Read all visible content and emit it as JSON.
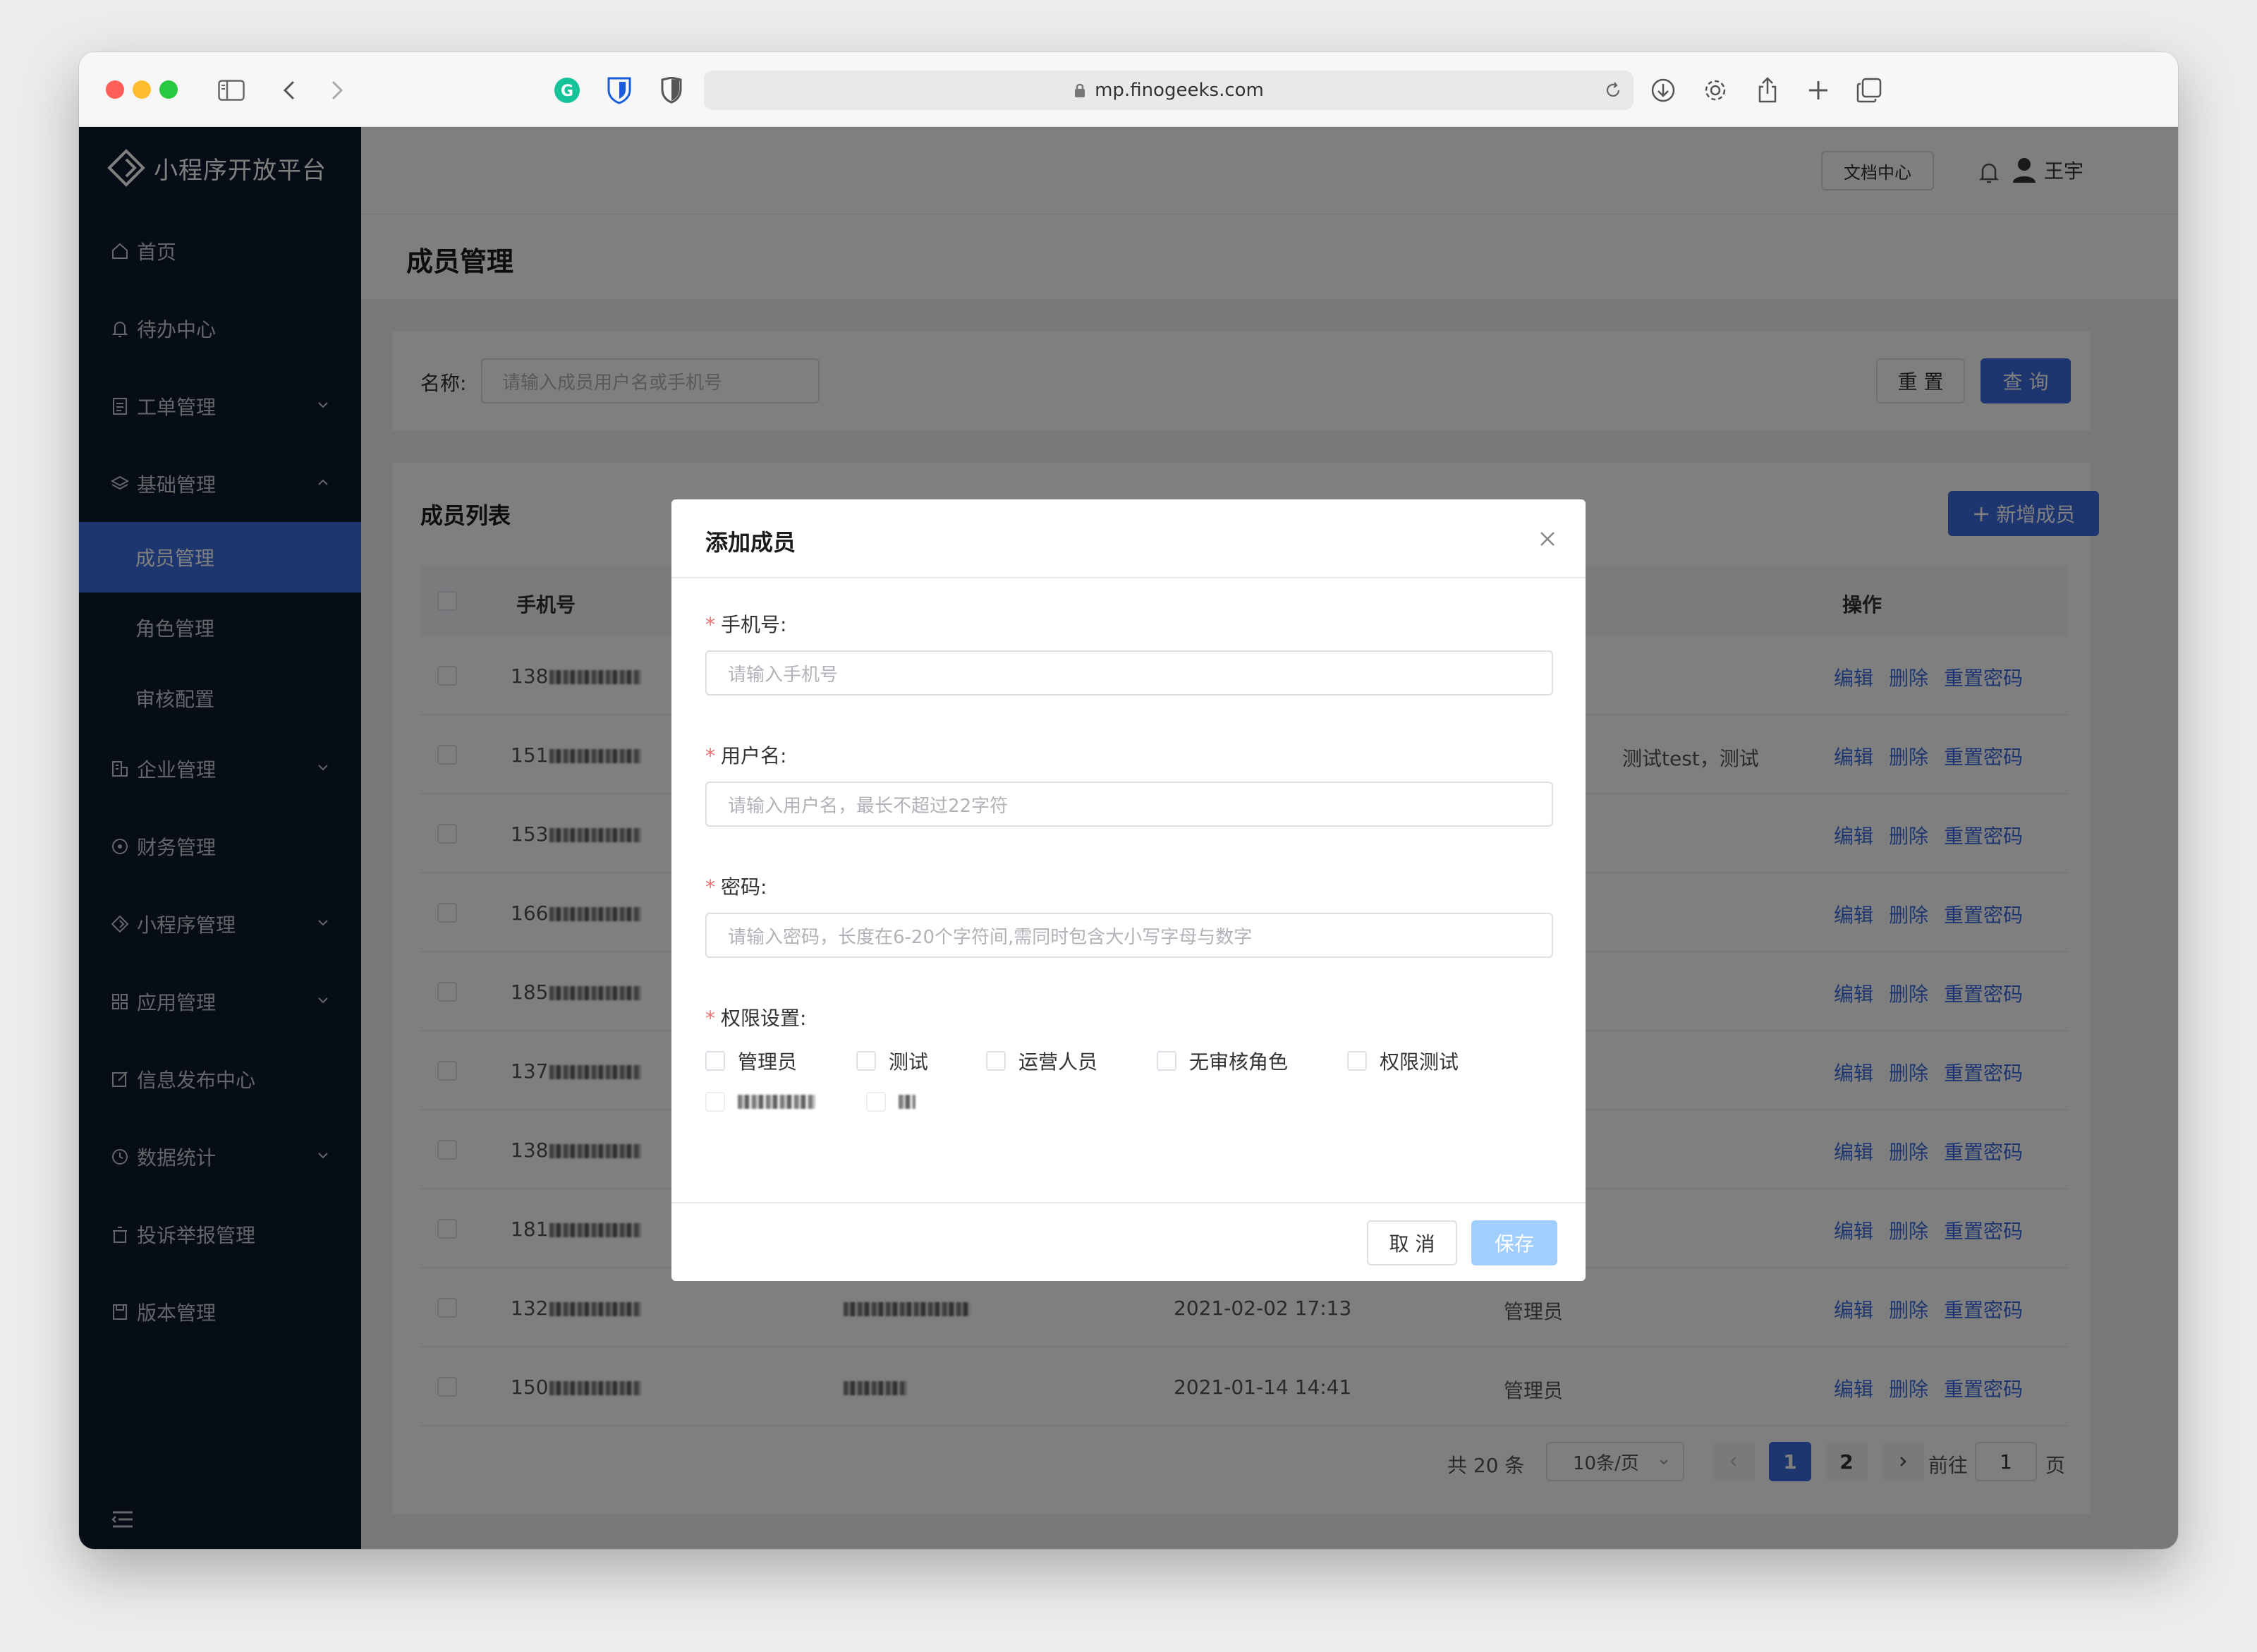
{
  "browser": {
    "url": "mp.finogeeks.com"
  },
  "sidebar": {
    "logo": "小程序开放平台",
    "items": [
      {
        "label": "首页",
        "icon": "home-icon",
        "expandable": false
      },
      {
        "label": "待办中心",
        "icon": "bell-icon",
        "expandable": false
      },
      {
        "label": "工单管理",
        "icon": "document-icon",
        "expandable": true
      },
      {
        "label": "基础管理",
        "icon": "layers-icon",
        "expandable": true,
        "expanded": true
      },
      {
        "label": "企业管理",
        "icon": "building-icon",
        "expandable": true
      },
      {
        "label": "财务管理",
        "icon": "finance-icon",
        "expandable": false
      },
      {
        "label": "小程序管理",
        "icon": "diamond-icon",
        "expandable": true
      },
      {
        "label": "应用管理",
        "icon": "grid-icon",
        "expandable": true
      },
      {
        "label": "信息发布中心",
        "icon": "edit-icon",
        "expandable": false
      },
      {
        "label": "数据统计",
        "icon": "clock-icon",
        "expandable": true
      },
      {
        "label": "投诉举报管理",
        "icon": "trash-icon",
        "expandable": false
      },
      {
        "label": "版本管理",
        "icon": "save-icon",
        "expandable": false
      }
    ],
    "sub_items": [
      {
        "label": "成员管理",
        "active": true
      },
      {
        "label": "角色管理",
        "active": false
      },
      {
        "label": "审核配置",
        "active": false
      }
    ]
  },
  "header": {
    "doc_center": "文档中心",
    "username": "王宇"
  },
  "page": {
    "title": "成员管理"
  },
  "filter": {
    "label": "名称:",
    "placeholder": "请输入成员用户名或手机号",
    "reset": "重 置",
    "search": "查 询"
  },
  "list": {
    "title": "成员列表",
    "add_button": "新增成员",
    "columns": {
      "phone": "手机号",
      "actions": "操作"
    },
    "action_labels": {
      "edit": "编辑",
      "delete": "删除",
      "reset_password": "重置密码"
    },
    "rows": [
      {
        "phone_prefix": "138",
        "name": "",
        "time": "",
        "role": ""
      },
      {
        "phone_prefix": "151",
        "name": "",
        "time": "",
        "role": "测试test，测试"
      },
      {
        "phone_prefix": "153",
        "name": "",
        "time": "",
        "role": ""
      },
      {
        "phone_prefix": "166",
        "name": "",
        "time": "",
        "role": ""
      },
      {
        "phone_prefix": "185",
        "name": "",
        "time": "",
        "role": ""
      },
      {
        "phone_prefix": "137",
        "name": "",
        "time": "",
        "role": ""
      },
      {
        "phone_prefix": "138",
        "name": "",
        "time": "",
        "role": ""
      },
      {
        "phone_prefix": "181",
        "name": "",
        "time": "",
        "role": ""
      },
      {
        "phone_prefix": "132",
        "name": "",
        "time": "2021-02-02 17:13",
        "role": "管理员"
      },
      {
        "phone_prefix": "150",
        "name": "",
        "time": "2021-01-14 14:41",
        "role": "管理员"
      }
    ]
  },
  "pagination": {
    "total": "共 20 条",
    "page_size": "10条/页",
    "pages": [
      "1",
      "2"
    ],
    "current": "1",
    "goto_label": "前往",
    "goto_value": "1",
    "page_unit": "页"
  },
  "modal": {
    "title": "添加成员",
    "phone_label": "手机号:",
    "phone_placeholder": "请输入手机号",
    "username_label": "用户名:",
    "username_placeholder": "请输入用户名，最长不超过22字符",
    "password_label": "密码:",
    "password_placeholder": "请输入密码，长度在6-20个字符间,需同时包含大小写字母与数字",
    "permission_label": "权限设置:",
    "permissions": [
      "管理员",
      "测试",
      "运营人员",
      "无审核角色",
      "权限测试"
    ],
    "cancel": "取 消",
    "save": "保存"
  },
  "colors": {
    "primary": "#3c6de0",
    "sidebar_bg": "#0f1a2d",
    "required_star": "#f56c6c",
    "save_disabled": "#a0cfff"
  }
}
